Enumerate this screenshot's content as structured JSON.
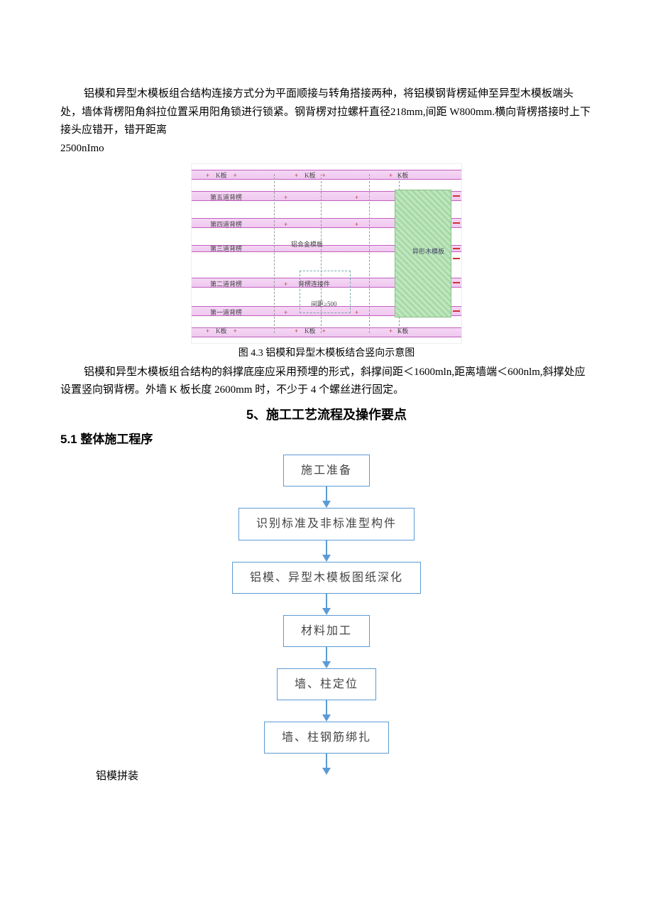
{
  "para1_line1": "铝模和异型木模板组合结构连接方式分为平面顺接与转角搭接两种，将铝模钢背楞延伸至异型木模板端头处，墙体背楞阳角斜拉位置采用阳角锁进行锁紧。钢背楞对拉螺杆直径218mm,间距 W800mm.横向背楞搭接时上下接头应错开，错开距离",
  "para1_line2": "2500nImo",
  "diagram43": {
    "top_labels": [
      "K板",
      "K板",
      "K板"
    ],
    "bottom_labels": [
      "K板",
      "K板",
      "K板"
    ],
    "row_labels": [
      "第五道背楞",
      "第四道背楞",
      "第三道背楞",
      "第二道背楞",
      "第一道背楞"
    ],
    "center_label": "铝合金模板",
    "right_label": "异形木模板",
    "mid_label": "背楞连接件",
    "dim_label": "间距≥500"
  },
  "caption43": "图 4.3 铝模和异型木模板结合竖向示意图",
  "para2": "铝模和异型木模板组合结构的斜撑底座应采用预埋的形式，斜撑间距＜1600mln,距离墙端＜600nlm,斜撑处应设置竖向钢背楞。外墙 K 板长度 2600mm 时，不少于 4 个螺丝进行固定。",
  "section5_title": "5、施工工艺流程及操作要点",
  "section51_title": "5.1 整体施工程序",
  "chart_data": {
    "type": "flowchart",
    "nodes": [
      "施工准备",
      "识别标准及非标准型构件",
      "铝模、异型木模板图纸深化",
      "材料加工",
      "墙、柱定位",
      "墙、柱钢筋绑扎"
    ],
    "trailing_arrow": true,
    "next_label_floating": "铝模拼装"
  }
}
